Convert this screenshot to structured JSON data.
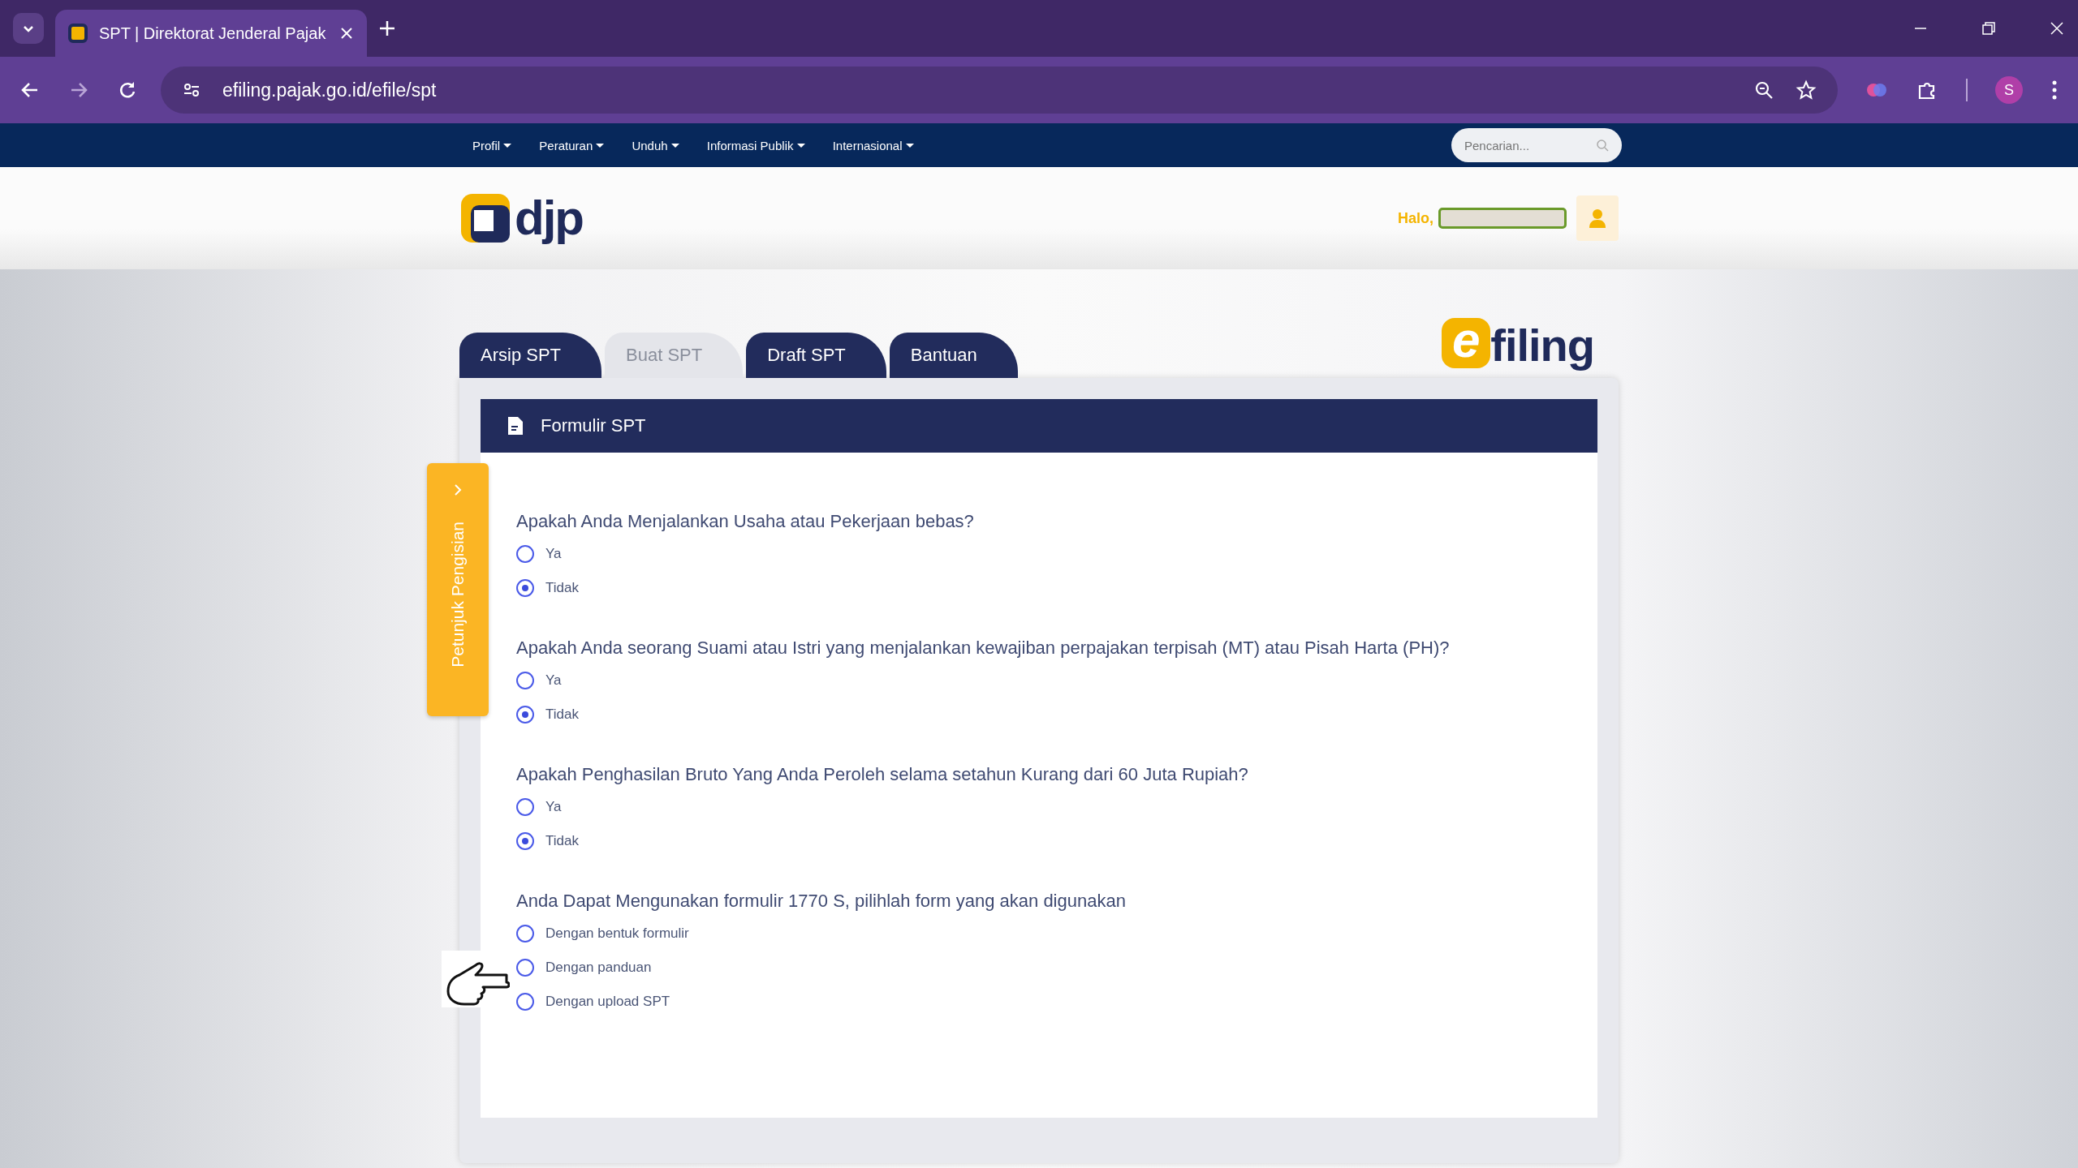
{
  "browser": {
    "tab_title": "SPT | Direktorat Jenderal Pajak",
    "url": "efiling.pajak.go.id/efile/spt",
    "profile_initial": "S"
  },
  "nav": {
    "items": [
      "Profil",
      "Peraturan",
      "Unduh",
      "Informasi Publik",
      "Internasional"
    ],
    "search": {
      "placeholder": "Pencarian..."
    }
  },
  "header": {
    "logo_text": "djp",
    "greeting": "Halo,",
    "efiling_logo": {
      "letter": "e",
      "text": "filing"
    }
  },
  "tabs": [
    {
      "label": "Arsip SPT",
      "selected": false
    },
    {
      "label": "Buat SPT",
      "selected": true
    },
    {
      "label": "Draft SPT",
      "selected": false
    },
    {
      "label": "Bantuan",
      "selected": false
    }
  ],
  "side_tab": {
    "label": "Petunjuk Pengisian"
  },
  "form": {
    "title": "Formulir SPT",
    "questions": [
      {
        "text": "Apakah Anda Menjalankan Usaha atau Pekerjaan bebas?",
        "options": [
          {
            "label": "Ya",
            "selected": false
          },
          {
            "label": "Tidak",
            "selected": true
          }
        ]
      },
      {
        "text": "Apakah Anda seorang Suami atau Istri yang menjalankan kewajiban perpajakan terpisah (MT) atau Pisah Harta (PH)?",
        "options": [
          {
            "label": "Ya",
            "selected": false
          },
          {
            "label": "Tidak",
            "selected": true
          }
        ]
      },
      {
        "text": "Apakah Penghasilan Bruto Yang Anda Peroleh selama setahun Kurang dari 60 Juta Rupiah?",
        "options": [
          {
            "label": "Ya",
            "selected": false
          },
          {
            "label": "Tidak",
            "selected": true
          }
        ]
      },
      {
        "text": "Anda Dapat Mengunakan formulir 1770 S, pilihlah form yang akan digunakan",
        "options": [
          {
            "label": "Dengan bentuk formulir",
            "selected": false
          },
          {
            "label": "Dengan panduan",
            "selected": false
          },
          {
            "label": "Dengan upload SPT",
            "selected": false
          }
        ]
      }
    ]
  }
}
